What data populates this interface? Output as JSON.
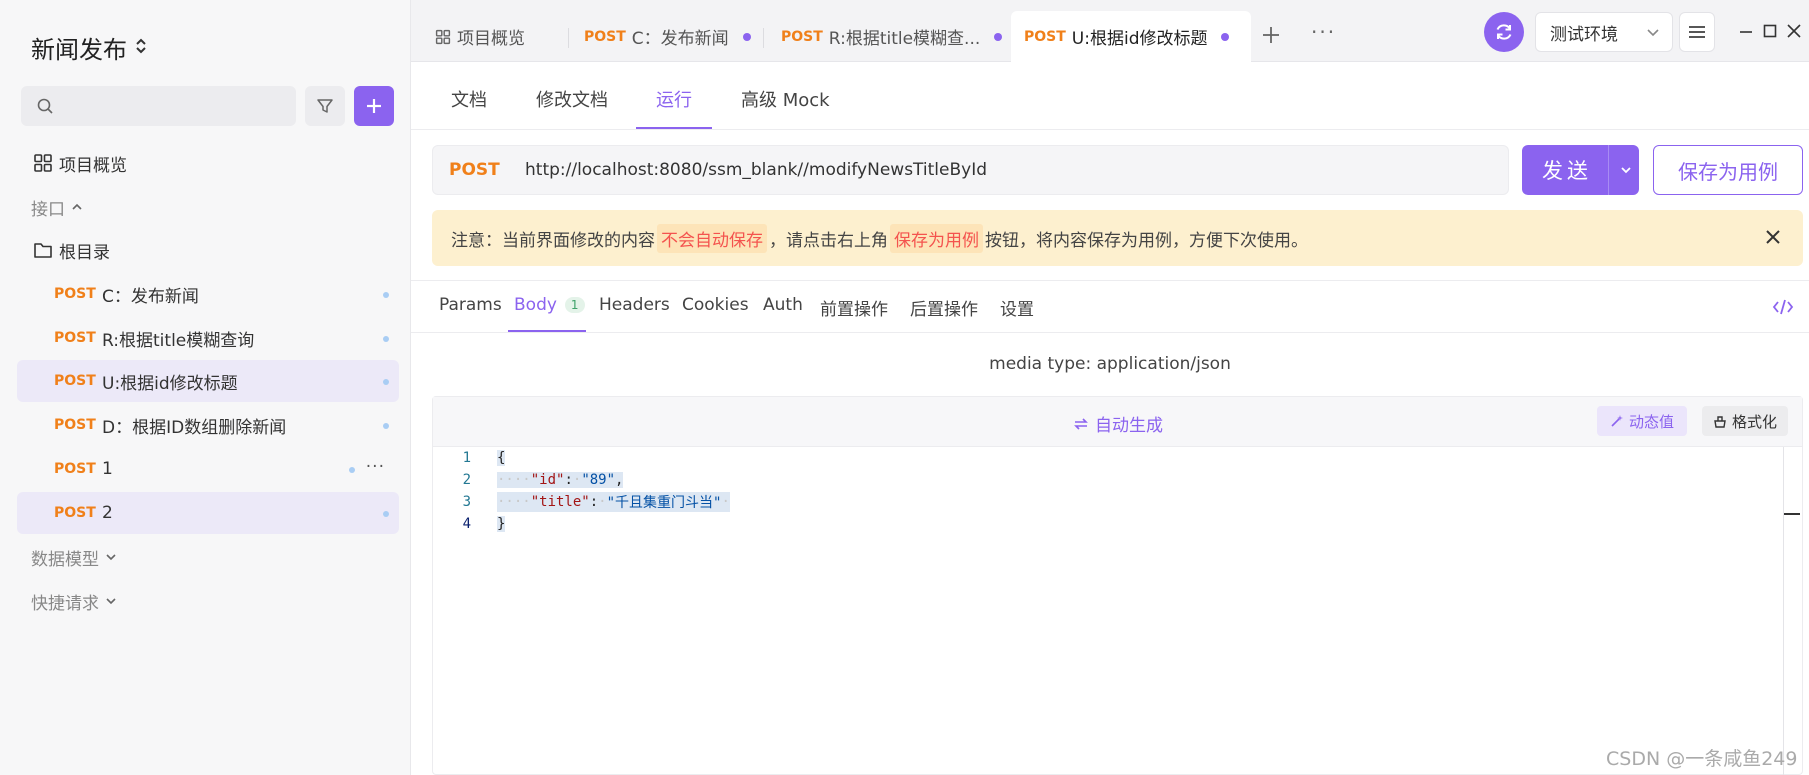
{
  "sidebar": {
    "project_title": "新闻发布",
    "overview_label": "项目概览",
    "section_api": "接口",
    "root_folder": "根目录",
    "items": [
      {
        "method": "POST",
        "name": "C：发布新闻"
      },
      {
        "method": "POST",
        "name": "R:根据title模糊查询"
      },
      {
        "method": "POST",
        "name": "U:根据id修改标题"
      },
      {
        "method": "POST",
        "name": "D：根据ID数组删除新闻"
      },
      {
        "method": "POST",
        "name": "1"
      },
      {
        "method": "POST",
        "name": "2"
      }
    ],
    "section_models": "数据模型",
    "section_quick": "快捷请求"
  },
  "tabs": {
    "overview": "项目概览",
    "items": [
      {
        "method": "POST",
        "name": "C：发布新闻"
      },
      {
        "method": "POST",
        "name": "R:根据title模糊查..."
      },
      {
        "method": "POST",
        "name": "U:根据id修改标题"
      }
    ],
    "more": "···",
    "env_label": "测试环境"
  },
  "subtabs": [
    "文档",
    "修改文档",
    "运行",
    "高级 Mock"
  ],
  "request": {
    "method": "POST",
    "url": "http://localhost:8080/ssm_blank//modifyNewsTitleById",
    "send_label": "发送",
    "save_case_label": "保存为用例"
  },
  "notice": {
    "prefix": "注意：当前界面修改的内容",
    "hl1": "不会自动保存",
    "mid": "，请点击右上角",
    "hl2": "保存为用例",
    "suffix": "按钮，将内容保存为用例，方便下次使用。"
  },
  "req_tabs": {
    "params": "Params",
    "body": "Body",
    "body_count": "1",
    "headers": "Headers",
    "cookies": "Cookies",
    "auth": "Auth",
    "pre": "前置操作",
    "post": "后置操作",
    "settings": "设置"
  },
  "body": {
    "media_type": "media type: application/json",
    "auto_gen": "自动生成",
    "dynamic_value": "动态值",
    "format": "格式化",
    "lines": [
      {
        "num": "1",
        "open": "{"
      },
      {
        "num": "2",
        "key": "\"id\"",
        "value": "\"89\"",
        "trail": ","
      },
      {
        "num": "3",
        "key": "\"title\"",
        "value": "\"千且集重门斗当\"",
        "trail": ""
      },
      {
        "num": "4",
        "close": "}"
      }
    ]
  },
  "watermark": "CSDN @一条咸鱼249",
  "colors": {
    "accent": "#8b63ef",
    "method_post": "#f0801a",
    "notice_bg": "#fdf0cf",
    "notice_highlight": "#f4534e"
  }
}
